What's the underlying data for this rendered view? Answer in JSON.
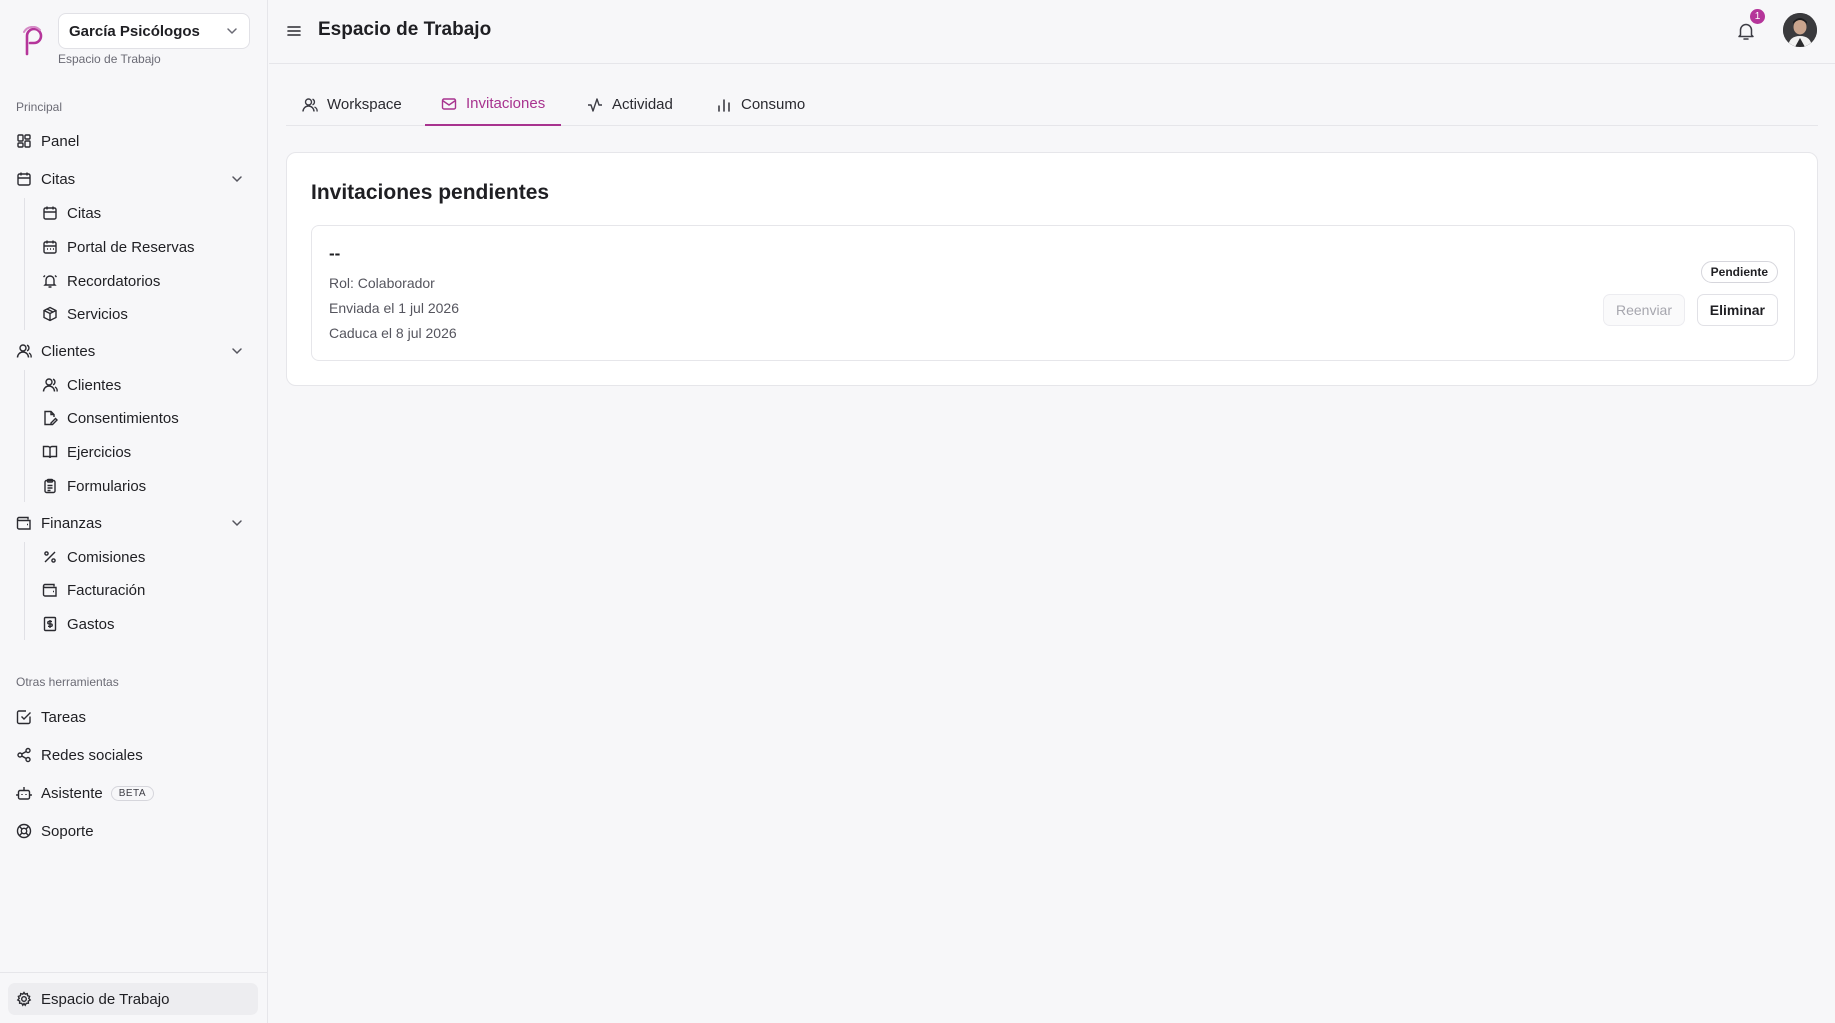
{
  "workspace": {
    "name": "García Psicólogos",
    "subtitle": "Espacio de Trabajo"
  },
  "sidebar": {
    "section_principal": "Principal",
    "panel": "Panel",
    "citas_group": "Citas",
    "citas_items": [
      "Citas",
      "Portal de Reservas",
      "Recordatorios",
      "Servicios"
    ],
    "clientes_group": "Clientes",
    "clientes_items": [
      "Clientes",
      "Consentimientos",
      "Ejercicios",
      "Formularios"
    ],
    "finanzas_group": "Finanzas",
    "finanzas_items": [
      "Comisiones",
      "Facturación",
      "Gastos"
    ],
    "section_otras": "Otras herramientas",
    "tareas": "Tareas",
    "redes": "Redes sociales",
    "asistente": "Asistente",
    "beta": "BETA",
    "soporte": "Soporte",
    "bottom": "Espacio de Trabajo"
  },
  "header": {
    "title": "Espacio de Trabajo",
    "notification_count": "1"
  },
  "tabs": [
    "Workspace",
    "Invitaciones",
    "Actividad",
    "Consumo"
  ],
  "invitations": {
    "title": "Invitaciones pendientes",
    "items": [
      {
        "email": "--",
        "role": "Rol: Colaborador",
        "sent": "Enviada el 1 jul 2026",
        "expires": "Caduca el 8 jul 2026",
        "status": "Pendiente",
        "resend": "Reenviar",
        "delete": "Eliminar"
      }
    ]
  },
  "colors": {
    "accent": "#a8338f",
    "background": "#f7f7f9",
    "card": "#ffffff"
  }
}
